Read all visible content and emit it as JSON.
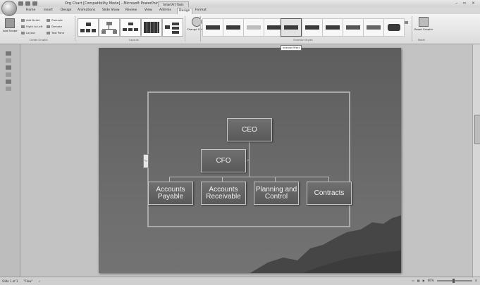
{
  "window": {
    "title": "Org Chart [Compatibility Mode] - Microsoft PowerPoint",
    "contextual_tab": "SmartArt Tools",
    "controls": "– ▫ ×"
  },
  "ribbon": {
    "tabs": [
      "Home",
      "Insert",
      "Design",
      "Animations",
      "Slide Show",
      "Review",
      "View",
      "Add-Ins",
      "Design",
      "Format"
    ],
    "active_tab_index": 8,
    "create_graphic": {
      "label": "Create Graphic",
      "add_shape": "Add Shape",
      "add_bullet": "Add Bullet",
      "right_to_left": "Right to Left",
      "layout": "Layout",
      "promote": "Promote",
      "demote": "Demote",
      "text_pane": "Text Pane"
    },
    "layouts_label": "Layouts",
    "change_colors": "Change Colors",
    "styles_label": "SmartArt Styles",
    "reset_graphic": "Reset Graphic",
    "reset_label": "Reset",
    "tooltip": "Intense Effect"
  },
  "org_chart": {
    "ceo": "CEO",
    "cfo": "CFO",
    "accounts_payable": "Accounts Payable",
    "accounts_receivable": "Accounts Receivable",
    "planning_control": "Planning and Control",
    "contracts": "Contracts"
  },
  "status": {
    "slide": "Slide 1 of 1",
    "theme": "\"Flow\"",
    "zoom": "66%"
  },
  "colors": {
    "slide_bg": "#646464",
    "node_fill": "#636363",
    "node_border": "#c8c8c8",
    "frame": "#aaaaaa"
  }
}
